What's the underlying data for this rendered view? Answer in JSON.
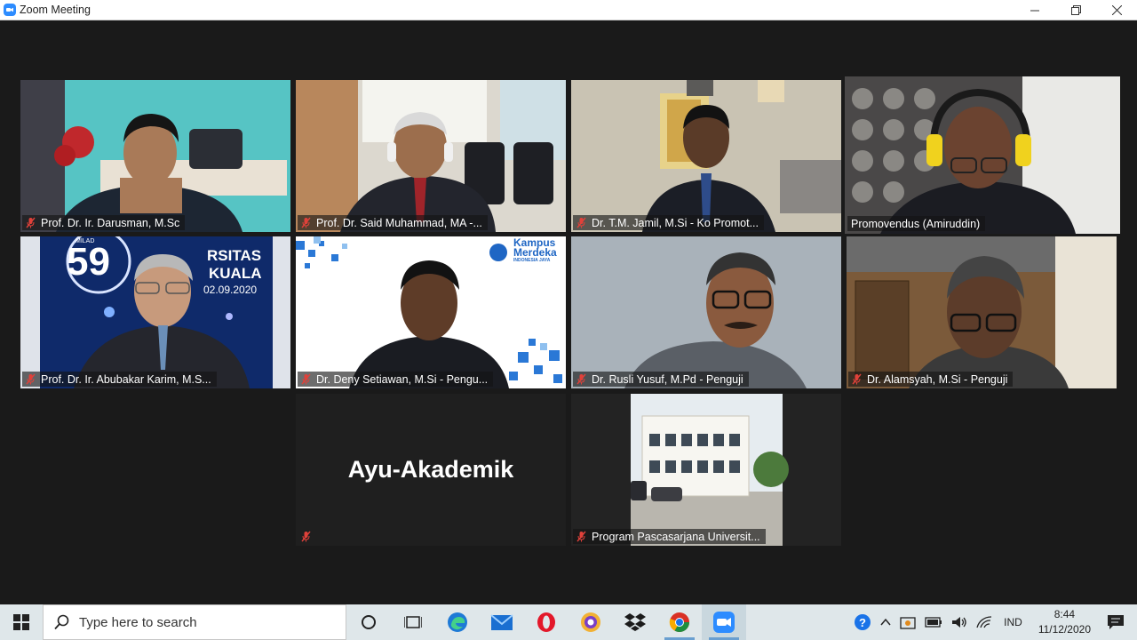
{
  "window": {
    "title": "Zoom Meeting"
  },
  "participants": [
    {
      "name": "Prof. Dr. Ir. Darusman, M.Sc",
      "muted": true
    },
    {
      "name": "Prof. Dr. Said Muhammad, MA -...",
      "muted": true
    },
    {
      "name": "Dr. T.M. Jamil, M.Si - Ko Promot...",
      "muted": true
    },
    {
      "name": "Promovendus (Amiruddin)",
      "muted": false,
      "active_speaker": true
    },
    {
      "name": "Prof. Dr. Ir. Abubakar Karim, M.S...",
      "muted": true
    },
    {
      "name": "Dr. Deny Setiawan, M.Si - Pengu...",
      "muted": true
    },
    {
      "name": "Dr. Rusli Yusuf, M.Pd - Penguji",
      "muted": true
    },
    {
      "name": "Dr. Alamsyah, M.Si - Penguji",
      "muted": true
    },
    {
      "name": "Ayu-Akademik",
      "muted": true,
      "video_off": true
    },
    {
      "name": "Program Pascasarjana Universit...",
      "muted": true
    }
  ],
  "backgrounds": {
    "abubakar_number": "59",
    "abubakar_word1": "RSITAS",
    "abubakar_word2": "KUALA",
    "abubakar_date": "02.09.2020",
    "abubakar_small": "MILAD",
    "deny_logo_line1": "Kampus",
    "deny_logo_line2": "Merdeka",
    "deny_logo_line3": "INDONESIA JAYA"
  },
  "taskbar": {
    "search_placeholder": "Type here to search",
    "language": "IND",
    "time": "8:44",
    "date": "11/12/2020"
  },
  "colors": {
    "active_speaker_border": "#c7d84a",
    "mute_icon": "#e0413a",
    "zoom_blue": "#2d8cff"
  }
}
